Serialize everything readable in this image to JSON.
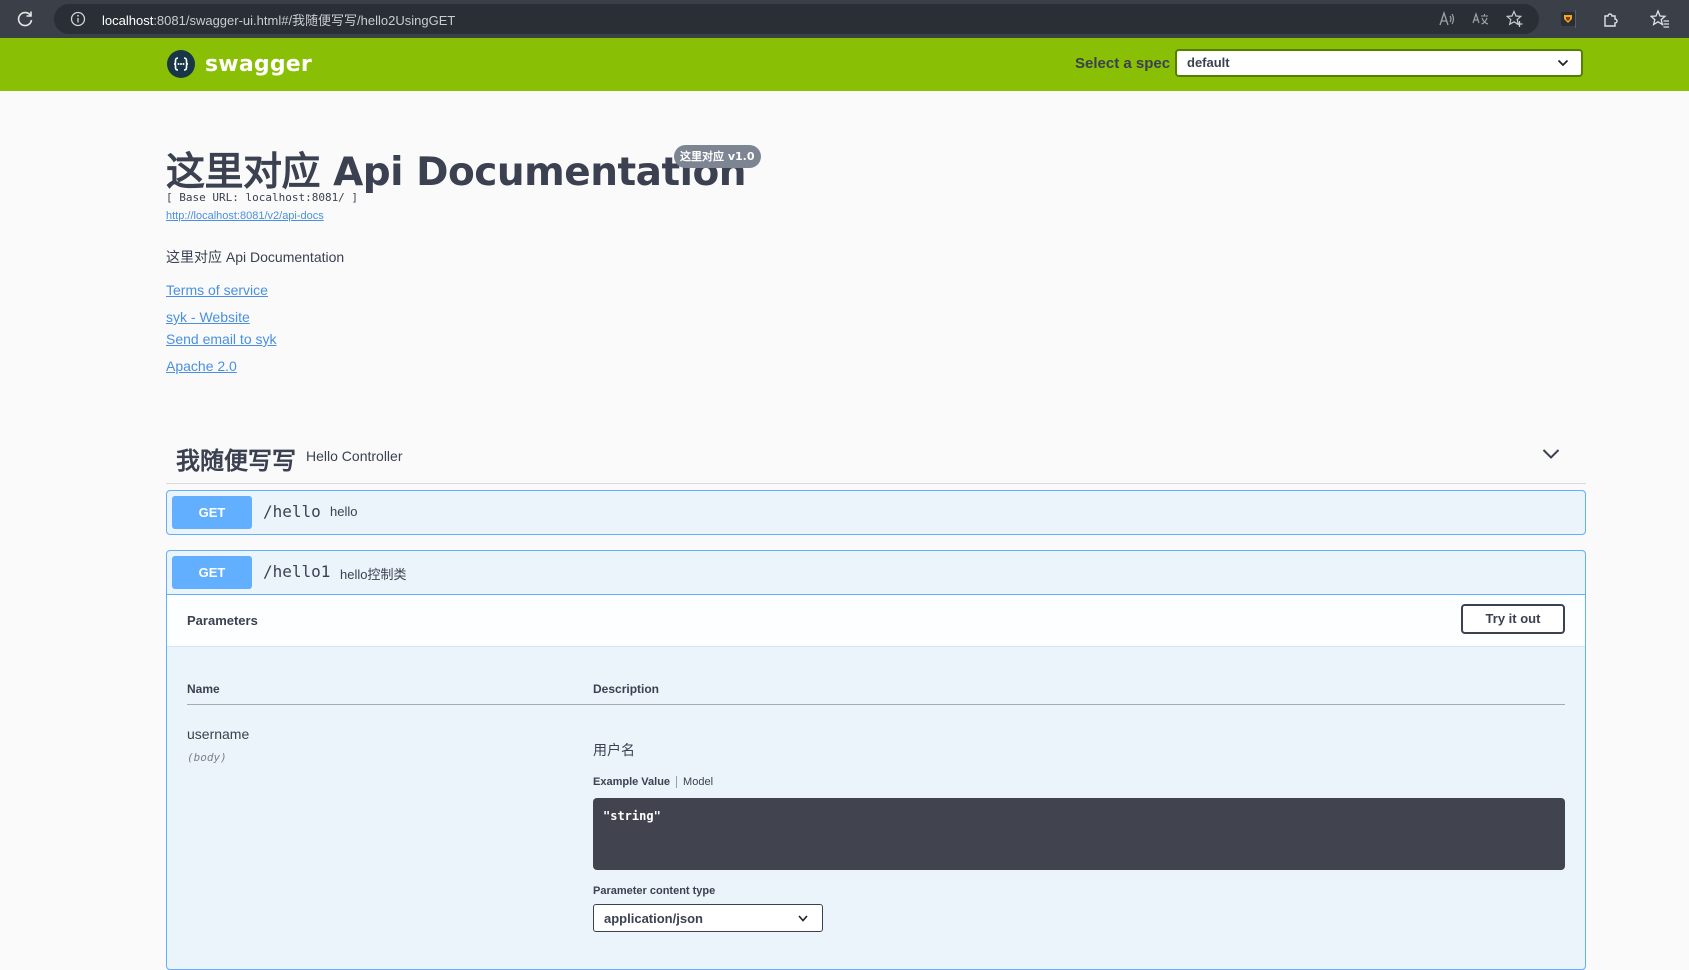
{
  "browser": {
    "url_host": "localhost",
    "url_rest": ":8081/swagger-ui.html#/我随便写写/hello2UsingGET"
  },
  "topbar": {
    "logo_text": "swagger",
    "spec_label": "Select a spec",
    "spec_value": "default",
    "accent_color": "#89bf04"
  },
  "info": {
    "title": "这里对应 Api Documentation",
    "version": "这里对应 v1.0",
    "base_url": "[ Base URL: localhost:8081/ ]",
    "api_docs_link": "http://localhost:8081/v2/api-docs",
    "description": "这里对应 Api Documentation",
    "terms": "Terms of service",
    "website": "syk - Website",
    "email": "Send email to syk",
    "license": "Apache 2.0"
  },
  "tag": {
    "name": "我随便写写",
    "description": "Hello Controller"
  },
  "operations": [
    {
      "method": "GET",
      "path": "/hello",
      "summary": "hello"
    },
    {
      "method": "GET",
      "path": "/hello1",
      "summary": "hello控制类"
    }
  ],
  "parameters": {
    "title": "Parameters",
    "try_it_out": "Try it out",
    "col_name": "Name",
    "col_description": "Description",
    "param_name": "username",
    "param_in": "(body)",
    "param_description": "用户名",
    "tab_example": "Example Value",
    "tab_model": "Model",
    "example_value": "\"string\"",
    "content_type_label": "Parameter content type",
    "content_type": "application/json"
  }
}
